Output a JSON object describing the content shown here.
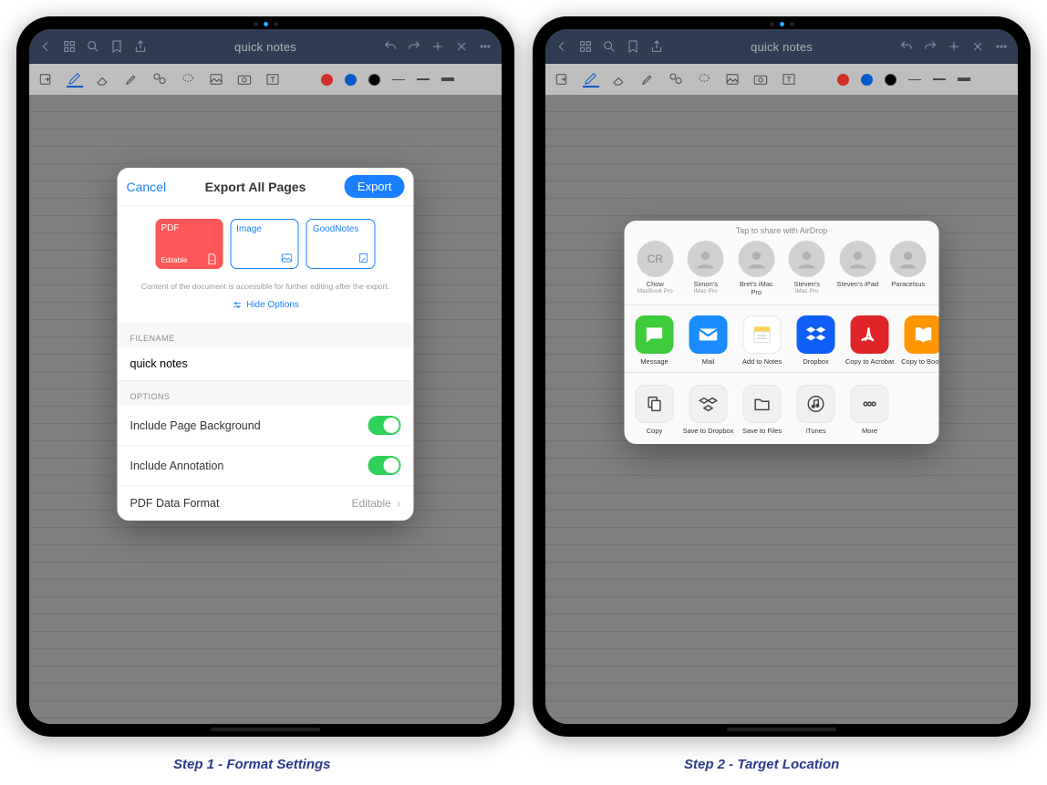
{
  "captions": {
    "step1": "Step 1 - Format Settings",
    "step2": "Step 2 - Target Location"
  },
  "nav": {
    "title": "quick notes",
    "accent": "#1a80ff"
  },
  "export": {
    "cancel": "Cancel",
    "title": "Export All Pages",
    "action": "Export",
    "formats": {
      "pdf": {
        "label": "PDF",
        "sub": "Editable"
      },
      "image": {
        "label": "Image"
      },
      "goodnotes": {
        "label": "GoodNotes"
      }
    },
    "note": "Content of the document is accessible for further editing after the export.",
    "hide": "Hide Options",
    "filename_header": "FILENAME",
    "filename": "quick notes",
    "options_header": "OPTIONS",
    "opt_bg": "Include Page Background",
    "opt_anno": "Include Annotation",
    "opt_pdf": "PDF Data Format",
    "opt_pdf_val": "Editable"
  },
  "share": {
    "caption": "Tap to share with AirDrop",
    "airdrop": [
      {
        "initials": "CR",
        "name": "Chow",
        "sub": "MacBook Pro"
      },
      {
        "name": "Simon's",
        "sub": "iMac Pro"
      },
      {
        "name": "Bret's iMac Pro",
        "sub": ""
      },
      {
        "name": "Steven's",
        "sub": "iMac Pro"
      },
      {
        "name": "Steven's iPad",
        "sub": ""
      },
      {
        "name": "Paracelsus",
        "sub": ""
      }
    ],
    "apps": [
      {
        "label": "Message",
        "bg": "#3ecb3c"
      },
      {
        "label": "Mail",
        "bg": "#1a8cff"
      },
      {
        "label": "Add to Notes",
        "bg": "#fff"
      },
      {
        "label": "Dropbox",
        "bg": "#0f5ef7"
      },
      {
        "label": "Copy to Acrobat",
        "bg": "#e0252a"
      },
      {
        "label": "Copy to Books",
        "bg": "#ff9500"
      }
    ],
    "actions": [
      {
        "label": "Copy"
      },
      {
        "label": "Save to Dropbox"
      },
      {
        "label": "Save to Files"
      },
      {
        "label": "iTunes"
      },
      {
        "label": "More"
      }
    ]
  },
  "tool_colors": {
    "red": "#ff3b30",
    "blue": "#0b6df6",
    "black": "#000"
  }
}
